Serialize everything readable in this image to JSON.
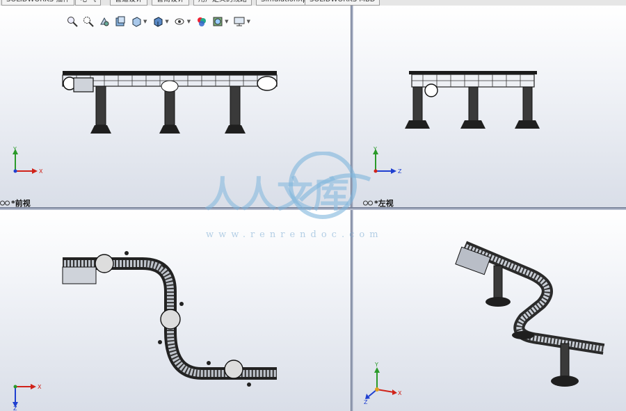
{
  "tabs": [
    {
      "label": "SOLIDWORKS 插件"
    },
    {
      "label": "电 气"
    },
    {
      "label": "管道设计"
    },
    {
      "label": "管筒设计"
    },
    {
      "label": "用户定义的线路"
    },
    {
      "label": "SimulationXpress"
    },
    {
      "label": "SOLIDWORKS MBD"
    }
  ],
  "toolbar": {
    "icons": [
      "zoom-to-fit-icon",
      "zoom-to-area-icon",
      "previous-view-icon",
      "section-view-icon",
      "view-orientation-icon",
      "display-style-icon",
      "hide-show-items-icon",
      "edit-appearance-icon",
      "apply-scene-icon",
      "view-settings-icon"
    ]
  },
  "viewports": {
    "top_left": {
      "label": "*前视"
    },
    "top_right": {
      "label": "*左视"
    },
    "bottom_left": {
      "label": ""
    },
    "bottom_right": {
      "label": ""
    }
  },
  "triads": {
    "top_left": {
      "x": "X",
      "y": "Y"
    },
    "top_right": {
      "y": "Y",
      "z": "Z"
    },
    "bottom_left": {
      "x": "X",
      "z": "Z"
    },
    "bottom_right": {
      "x": "X",
      "y": "Y",
      "z": "Z"
    }
  },
  "watermark": {
    "text": "人人文库",
    "url": "www.renrendoc.com"
  },
  "colors": {
    "viewport_bg_top": "#ffffff",
    "viewport_bg_bottom": "#d9dee8",
    "axis_x": "#d0231a",
    "axis_y": "#2a9a2a",
    "axis_z": "#1f3fd0",
    "axis_origin": "#e0a020",
    "watermark": "#7fb6dc"
  }
}
